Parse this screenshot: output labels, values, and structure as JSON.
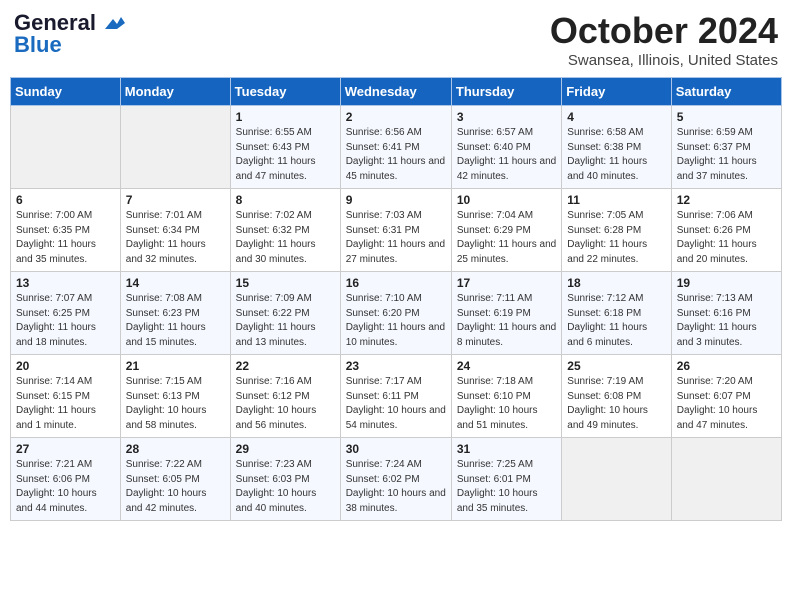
{
  "header": {
    "logo_line1": "General",
    "logo_line2": "Blue",
    "month": "October 2024",
    "location": "Swansea, Illinois, United States"
  },
  "weekdays": [
    "Sunday",
    "Monday",
    "Tuesday",
    "Wednesday",
    "Thursday",
    "Friday",
    "Saturday"
  ],
  "weeks": [
    [
      {
        "day": "",
        "info": ""
      },
      {
        "day": "",
        "info": ""
      },
      {
        "day": "1",
        "info": "Sunrise: 6:55 AM\nSunset: 6:43 PM\nDaylight: 11 hours and 47 minutes."
      },
      {
        "day": "2",
        "info": "Sunrise: 6:56 AM\nSunset: 6:41 PM\nDaylight: 11 hours and 45 minutes."
      },
      {
        "day": "3",
        "info": "Sunrise: 6:57 AM\nSunset: 6:40 PM\nDaylight: 11 hours and 42 minutes."
      },
      {
        "day": "4",
        "info": "Sunrise: 6:58 AM\nSunset: 6:38 PM\nDaylight: 11 hours and 40 minutes."
      },
      {
        "day": "5",
        "info": "Sunrise: 6:59 AM\nSunset: 6:37 PM\nDaylight: 11 hours and 37 minutes."
      }
    ],
    [
      {
        "day": "6",
        "info": "Sunrise: 7:00 AM\nSunset: 6:35 PM\nDaylight: 11 hours and 35 minutes."
      },
      {
        "day": "7",
        "info": "Sunrise: 7:01 AM\nSunset: 6:34 PM\nDaylight: 11 hours and 32 minutes."
      },
      {
        "day": "8",
        "info": "Sunrise: 7:02 AM\nSunset: 6:32 PM\nDaylight: 11 hours and 30 minutes."
      },
      {
        "day": "9",
        "info": "Sunrise: 7:03 AM\nSunset: 6:31 PM\nDaylight: 11 hours and 27 minutes."
      },
      {
        "day": "10",
        "info": "Sunrise: 7:04 AM\nSunset: 6:29 PM\nDaylight: 11 hours and 25 minutes."
      },
      {
        "day": "11",
        "info": "Sunrise: 7:05 AM\nSunset: 6:28 PM\nDaylight: 11 hours and 22 minutes."
      },
      {
        "day": "12",
        "info": "Sunrise: 7:06 AM\nSunset: 6:26 PM\nDaylight: 11 hours and 20 minutes."
      }
    ],
    [
      {
        "day": "13",
        "info": "Sunrise: 7:07 AM\nSunset: 6:25 PM\nDaylight: 11 hours and 18 minutes."
      },
      {
        "day": "14",
        "info": "Sunrise: 7:08 AM\nSunset: 6:23 PM\nDaylight: 11 hours and 15 minutes."
      },
      {
        "day": "15",
        "info": "Sunrise: 7:09 AM\nSunset: 6:22 PM\nDaylight: 11 hours and 13 minutes."
      },
      {
        "day": "16",
        "info": "Sunrise: 7:10 AM\nSunset: 6:20 PM\nDaylight: 11 hours and 10 minutes."
      },
      {
        "day": "17",
        "info": "Sunrise: 7:11 AM\nSunset: 6:19 PM\nDaylight: 11 hours and 8 minutes."
      },
      {
        "day": "18",
        "info": "Sunrise: 7:12 AM\nSunset: 6:18 PM\nDaylight: 11 hours and 6 minutes."
      },
      {
        "day": "19",
        "info": "Sunrise: 7:13 AM\nSunset: 6:16 PM\nDaylight: 11 hours and 3 minutes."
      }
    ],
    [
      {
        "day": "20",
        "info": "Sunrise: 7:14 AM\nSunset: 6:15 PM\nDaylight: 11 hours and 1 minute."
      },
      {
        "day": "21",
        "info": "Sunrise: 7:15 AM\nSunset: 6:13 PM\nDaylight: 10 hours and 58 minutes."
      },
      {
        "day": "22",
        "info": "Sunrise: 7:16 AM\nSunset: 6:12 PM\nDaylight: 10 hours and 56 minutes."
      },
      {
        "day": "23",
        "info": "Sunrise: 7:17 AM\nSunset: 6:11 PM\nDaylight: 10 hours and 54 minutes."
      },
      {
        "day": "24",
        "info": "Sunrise: 7:18 AM\nSunset: 6:10 PM\nDaylight: 10 hours and 51 minutes."
      },
      {
        "day": "25",
        "info": "Sunrise: 7:19 AM\nSunset: 6:08 PM\nDaylight: 10 hours and 49 minutes."
      },
      {
        "day": "26",
        "info": "Sunrise: 7:20 AM\nSunset: 6:07 PM\nDaylight: 10 hours and 47 minutes."
      }
    ],
    [
      {
        "day": "27",
        "info": "Sunrise: 7:21 AM\nSunset: 6:06 PM\nDaylight: 10 hours and 44 minutes."
      },
      {
        "day": "28",
        "info": "Sunrise: 7:22 AM\nSunset: 6:05 PM\nDaylight: 10 hours and 42 minutes."
      },
      {
        "day": "29",
        "info": "Sunrise: 7:23 AM\nSunset: 6:03 PM\nDaylight: 10 hours and 40 minutes."
      },
      {
        "day": "30",
        "info": "Sunrise: 7:24 AM\nSunset: 6:02 PM\nDaylight: 10 hours and 38 minutes."
      },
      {
        "day": "31",
        "info": "Sunrise: 7:25 AM\nSunset: 6:01 PM\nDaylight: 10 hours and 35 minutes."
      },
      {
        "day": "",
        "info": ""
      },
      {
        "day": "",
        "info": ""
      }
    ]
  ]
}
